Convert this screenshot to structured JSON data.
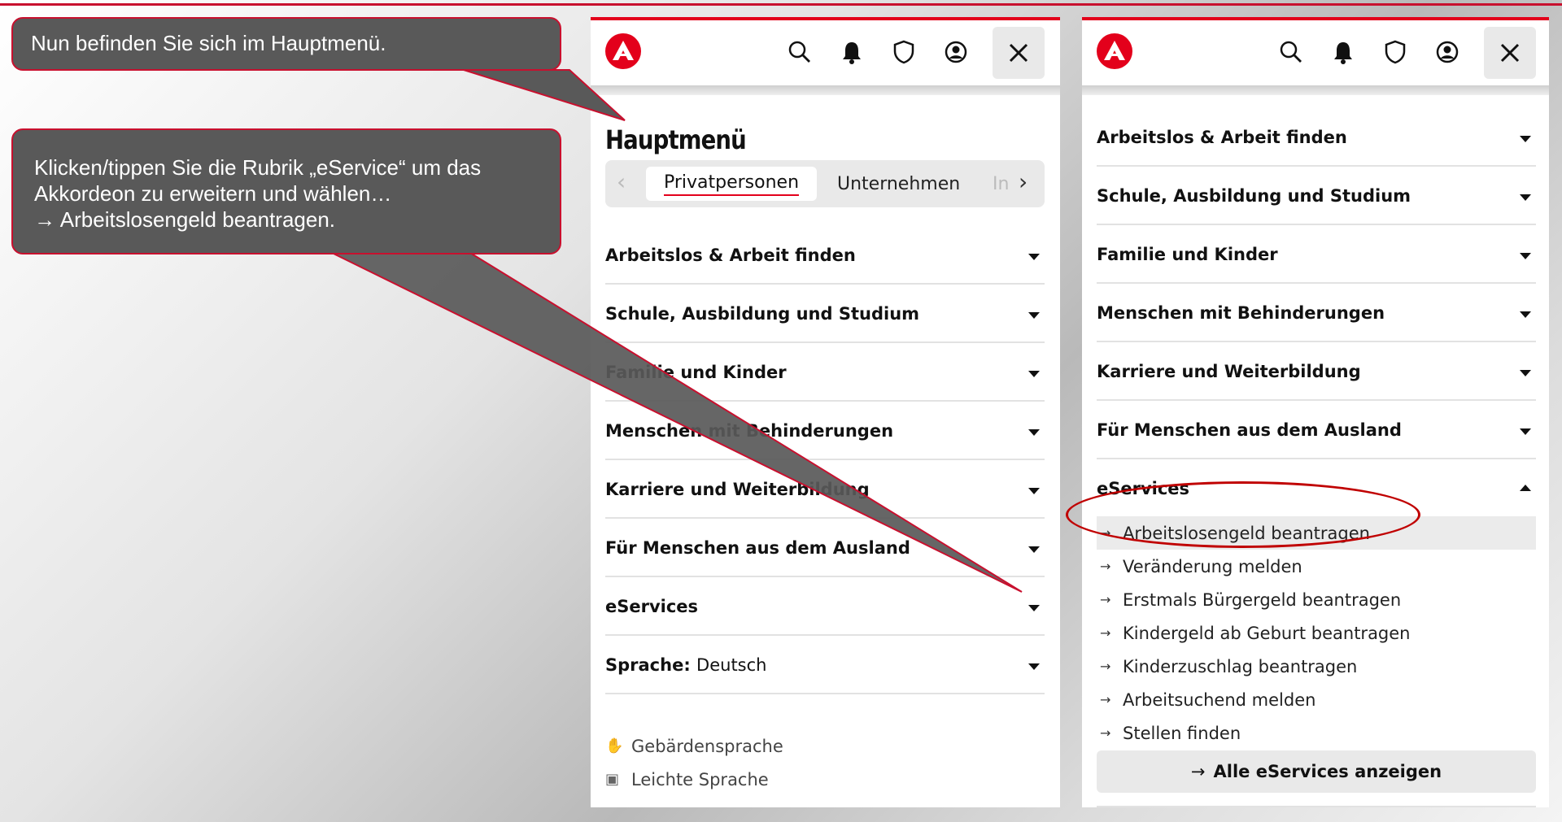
{
  "callouts": {
    "first": "Nun befinden Sie sich im Hauptmenü.",
    "second": "Klicken/tippen Sie die Rubrik „eService“ um das\nAkkordeon zu erweitern und wählen…\n→ Arbeitslosengeld beantragen."
  },
  "colors": {
    "brand_red": "#e3001b",
    "callout_bg": "#595959",
    "callout_border": "#c8102e"
  },
  "header_icons": [
    "logo-icon",
    "search-icon",
    "bell-icon",
    "shield-icon",
    "user-icon",
    "close-icon"
  ],
  "left_panel": {
    "title": "Hauptmenü",
    "tabs": {
      "active": "Privatpersonen",
      "second": "Unternehmen",
      "third": "In"
    },
    "items": [
      "Arbeitslos & Arbeit finden",
      "Schule, Ausbildung und Studium",
      "Familie und Kinder",
      "Menschen mit Behinderungen",
      "Karriere und Weiterbildung",
      "Für Menschen aus dem Ausland",
      "eServices"
    ],
    "language_label": "Sprache:",
    "language_value": "Deutsch",
    "footer_links": [
      "Gebärdensprache",
      "Leichte Sprache"
    ]
  },
  "right_panel": {
    "items": [
      "Arbeitslos & Arbeit finden",
      "Schule, Ausbildung und Studium",
      "Familie und Kinder",
      "Menschen mit Behinderungen",
      "Karriere und Weiterbildung",
      "Für Menschen aus dem Ausland"
    ],
    "expanded_item": "eServices",
    "sub_items": [
      "Arbeitslosengeld beantragen",
      "Veränderung melden",
      "Erstmals Bürgergeld beantragen",
      "Kindergeld ab Geburt beantragen",
      "Kinderzuschlag beantragen",
      "Arbeitsuchend melden",
      "Stellen finden"
    ],
    "all_button": "Alle eServices anzeigen"
  }
}
